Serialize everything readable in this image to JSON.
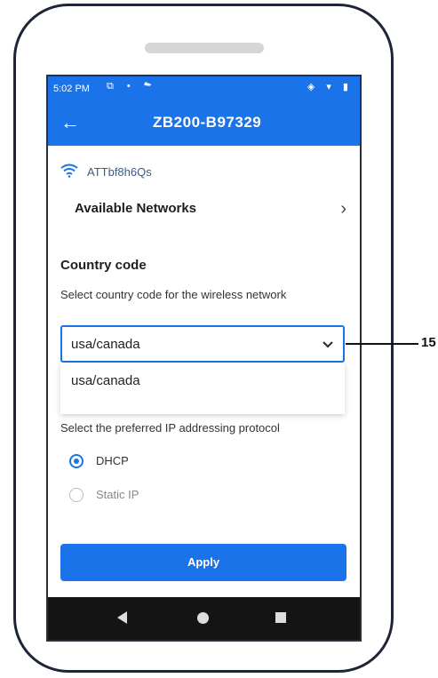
{
  "status_bar": {
    "time": "5:02 PM",
    "left_icons": "⧉ • ☁",
    "right_icons": "◈ ▾ ▮"
  },
  "app_bar": {
    "title": "ZB200-B97329",
    "back_icon": "arrow-left-icon"
  },
  "wifi": {
    "ssid": "ATTbf8h6Qs",
    "icon": "wifi-icon"
  },
  "available_networks": {
    "label": "Available Networks",
    "icon": "chevron-right-icon"
  },
  "country_code": {
    "title": "Country code",
    "description": "Select country code for the wireless network",
    "selected": "usa/canada",
    "options": [
      "usa/canada"
    ]
  },
  "ip_protocol": {
    "description": "Select the preferred IP addressing protocol",
    "options": [
      {
        "label": "DHCP",
        "selected": true
      },
      {
        "label": "Static IP",
        "selected": false
      }
    ]
  },
  "apply_button": {
    "label": "Apply"
  },
  "callout": {
    "label": "15"
  },
  "colors": {
    "accent": "#1a73e8",
    "nav_bar": "#141414",
    "phone_frame": "#1e2536"
  }
}
